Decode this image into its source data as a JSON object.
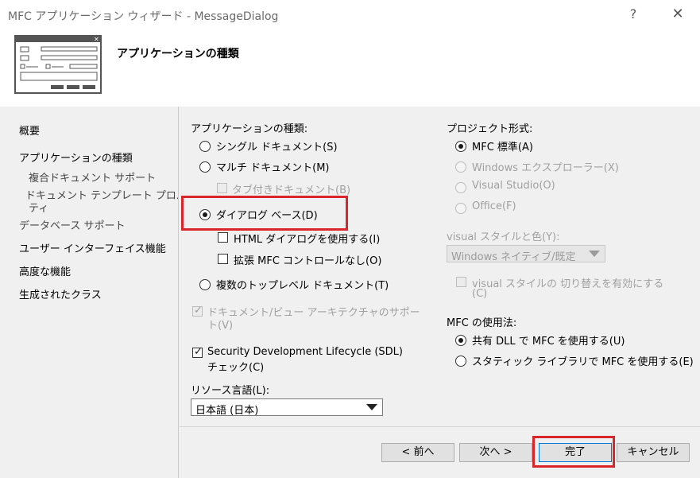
{
  "window": {
    "title": "MFC アプリケーション ウィザード - MessageDialog",
    "help": "?",
    "close": "✕"
  },
  "header": {
    "title": "アプリケーションの種類"
  },
  "sidebar": {
    "items": [
      {
        "label": "概要"
      },
      {
        "label": "アプリケーションの種類"
      },
      {
        "label": "複合ドキュメント サポート"
      },
      {
        "label": "ドキュメント テンプレート プロパ"
      },
      {
        "label": "ティ"
      },
      {
        "label": "データベース サポート"
      },
      {
        "label": "ユーザー インターフェイス機能"
      },
      {
        "label": "高度な機能"
      },
      {
        "label": "生成されたクラス"
      }
    ]
  },
  "app_type": {
    "heading": "アプリケーションの種類:",
    "single_doc": "シングル ドキュメント(S)",
    "multi_doc": "マルチ ドキュメント(M)",
    "tabbed_doc": "タブ付きドキュメント(B)",
    "dialog_based": "ダイアログ ベース(D)",
    "html_dialog": "HTML ダイアログを使用する(I)",
    "no_mfc_controls": "拡張 MFC コントロールなし(O)",
    "multiple_top": "複数のトップレベル ドキュメント(T)",
    "docview_line1": "ドキュメント/ビュー アーキテクチャのサポー",
    "docview_line2": "ト(V)",
    "sdl_line1": "Security Development Lifecycle (SDL)",
    "sdl_line2": "チェック(C)",
    "selected": "dialog_based"
  },
  "resource_lang": {
    "label": "リソース言語(L):",
    "value": "日本語 (日本)"
  },
  "project_style": {
    "heading": "プロジェクト形式:",
    "mfc_standard": "MFC 標準(A)",
    "windows_explorer": "Windows エクスプローラー(X)",
    "visual_studio": "Visual Studio(O)",
    "office": "Office(F)",
    "selected": "mfc_standard"
  },
  "visual_style": {
    "label": "visual スタイルと色(Y):",
    "value": "Windows ネイティブ/既定",
    "toggle_line1": "visual スタイルの 切り替えを有効にする",
    "toggle_line2": "(C)"
  },
  "mfc_usage": {
    "heading": "MFC の使用法:",
    "shared_dll": "共有 DLL で MFC を使用する(U)",
    "static_lib": "スタティック ライブラリで MFC を使用する(E)",
    "selected": "shared_dll"
  },
  "buttons": {
    "prev": "< 前へ",
    "next": "次へ >",
    "finish": "完了",
    "cancel": "キャンセル"
  },
  "highlight_color": "#d8262b"
}
